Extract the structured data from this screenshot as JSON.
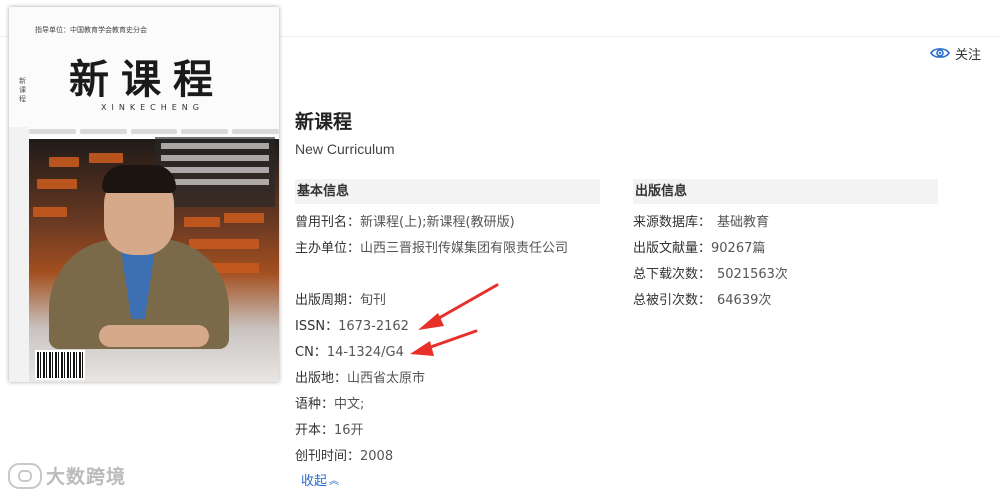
{
  "cover": {
    "title": "新课程",
    "pinyin": "XINKECHENG",
    "top_small": "指导单位：中国教育学会教育史分会",
    "side_text": "新课程",
    "issn_bar": "ISSN 1673-2162"
  },
  "follow": {
    "label": "关注",
    "icon": "eye-icon",
    "icon_color": "#2b6cd0"
  },
  "journal": {
    "title_cn": "新课程",
    "title_en": "New Curriculum"
  },
  "basic_info": {
    "heading": "基本信息",
    "rows": [
      {
        "key": "曾用刊名：",
        "value": "新课程(上);新课程(教研版)"
      },
      {
        "key": "主办单位：",
        "value": "山西三晋报刊传媒集团有限责任公司"
      },
      {
        "key": "出版周期：",
        "value": "旬刊"
      },
      {
        "key": "ISSN：",
        "value": "1673-2162"
      },
      {
        "key": "CN：",
        "value": "14-1324/G4"
      },
      {
        "key": "出版地：",
        "value": "山西省太原市"
      },
      {
        "key": "语种：",
        "value": "中文;"
      },
      {
        "key": "开本：",
        "value": "16开"
      },
      {
        "key": "创刊时间：",
        "value": "2008"
      }
    ]
  },
  "pub_info": {
    "heading": "出版信息",
    "rows": [
      {
        "key": "来源数据库：",
        "value": "基础教育"
      },
      {
        "key": "出版文献量：",
        "value": "90267篇"
      },
      {
        "key": "总下载次数：",
        "value": "5021563次"
      },
      {
        "key": "总被引次数：",
        "value": "64639次"
      }
    ]
  },
  "collapse": {
    "label": "收起",
    "icon": "chevron-up-icon"
  },
  "annotations": {
    "arrow_color": "#e8302a"
  },
  "watermark": {
    "text": "大数跨境"
  }
}
